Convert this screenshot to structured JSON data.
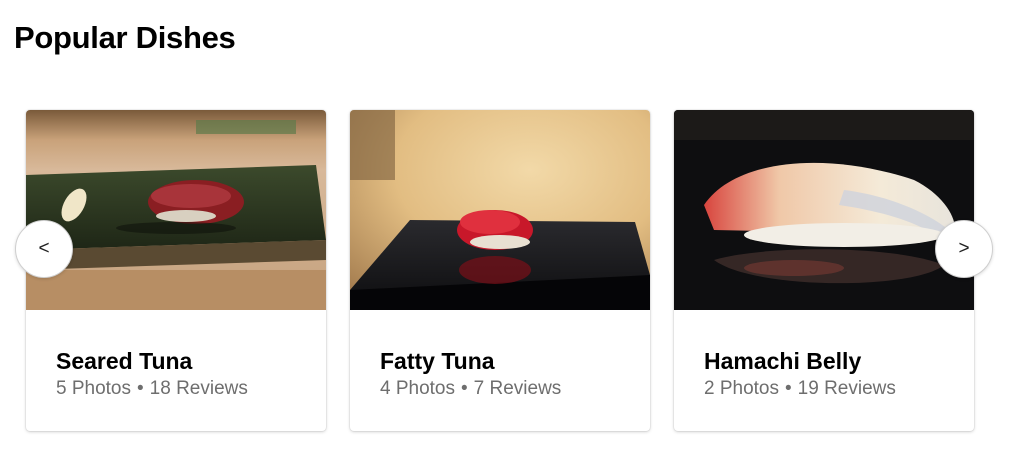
{
  "section": {
    "title": "Popular Dishes"
  },
  "carousel": {
    "prev_label": "<",
    "next_label": ">",
    "items": [
      {
        "name": "Seared Tuna",
        "photos": "5 Photos",
        "reviews": "18 Reviews"
      },
      {
        "name": "Fatty Tuna",
        "photos": "4 Photos",
        "reviews": "7 Reviews"
      },
      {
        "name": "Hamachi Belly",
        "photos": "2 Photos",
        "reviews": "19 Reviews"
      }
    ],
    "separator": "•"
  },
  "colors": {
    "title": "#000000",
    "meta": "#6e6e6e",
    "card_bg": "#ffffff"
  }
}
